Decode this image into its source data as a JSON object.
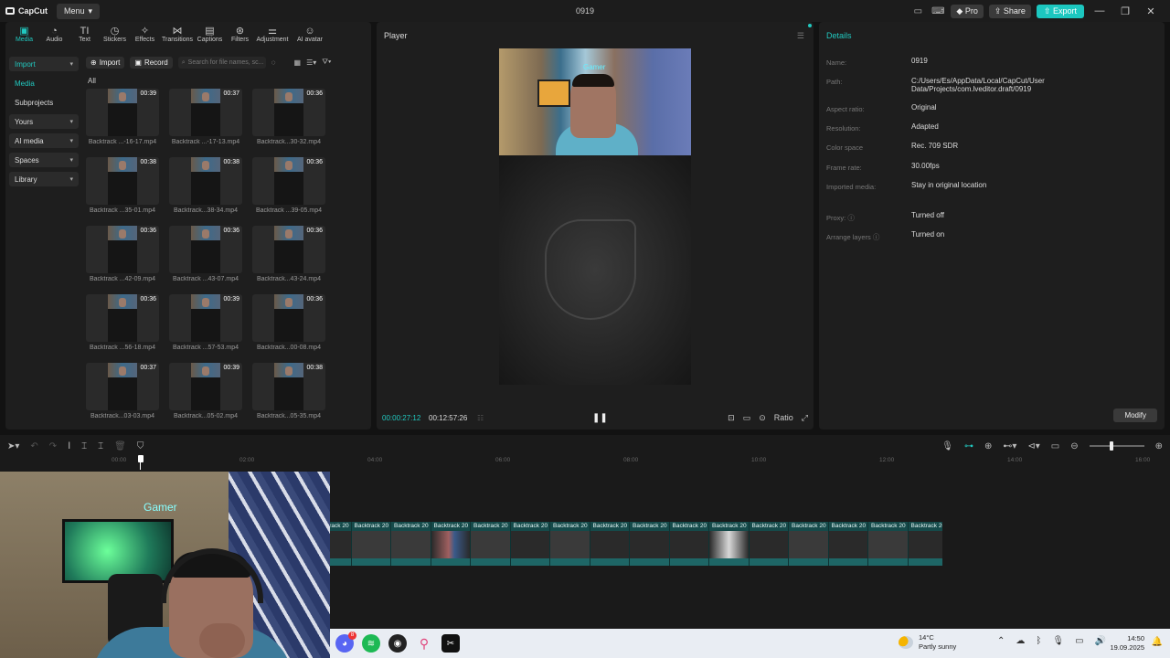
{
  "titlebar": {
    "logo": "CapCut",
    "menu_label": "Menu",
    "project_title": "0919",
    "pro_label": "Pro",
    "share_label": "Share",
    "export_label": "Export"
  },
  "toolbar": {
    "items": [
      {
        "label": "Media",
        "icon": "media-icon"
      },
      {
        "label": "Audio",
        "icon": "audio-icon"
      },
      {
        "label": "Text",
        "icon": "text-icon"
      },
      {
        "label": "Stickers",
        "icon": "stickers-icon"
      },
      {
        "label": "Effects",
        "icon": "effects-icon"
      },
      {
        "label": "Transitions",
        "icon": "transitions-icon"
      },
      {
        "label": "Captions",
        "icon": "captions-icon"
      },
      {
        "label": "Filters",
        "icon": "filters-icon"
      },
      {
        "label": "Adjustment",
        "icon": "adjustment-icon"
      },
      {
        "label": "AI avatar",
        "icon": "ai-avatar-icon"
      }
    ],
    "active": "Media"
  },
  "sidebar": {
    "items": [
      {
        "label": "Import"
      },
      {
        "label": "Media"
      },
      {
        "label": "Subprojects"
      },
      {
        "label": "Yours"
      },
      {
        "label": "AI media"
      },
      {
        "label": "Spaces"
      },
      {
        "label": "Library"
      }
    ]
  },
  "media": {
    "import_label": "Import",
    "record_label": "Record",
    "search_placeholder": "Search for file names, sc...",
    "all_label": "All",
    "clips": [
      {
        "name": "Backtrack ...-16-17.mp4",
        "duration": "00:39"
      },
      {
        "name": "Backtrack ...-17-13.mp4",
        "duration": "00:37"
      },
      {
        "name": "Backtrack...30-32.mp4",
        "duration": "00:36"
      },
      {
        "name": "Backtrack ...35-01.mp4",
        "duration": "00:38"
      },
      {
        "name": "Backtrack...38-34.mp4",
        "duration": "00:38"
      },
      {
        "name": "Backtrack ...39-05.mp4",
        "duration": "00:36"
      },
      {
        "name": "Backtrack ...42-09.mp4",
        "duration": "00:36"
      },
      {
        "name": "Backtrack ...43-07.mp4",
        "duration": "00:36"
      },
      {
        "name": "Backtrack...43-24.mp4",
        "duration": "00:36"
      },
      {
        "name": "Backtrack ...56-18.mp4",
        "duration": "00:36"
      },
      {
        "name": "Backtrack ...57-53.mp4",
        "duration": "00:39"
      },
      {
        "name": "Backtrack...00-08.mp4",
        "duration": "00:36"
      },
      {
        "name": "Backtrack...03-03.mp4",
        "duration": "00:37"
      },
      {
        "name": "Backtrack...05-02.mp4",
        "duration": "00:39"
      },
      {
        "name": "Backtrack...05-35.mp4",
        "duration": "00:38"
      }
    ]
  },
  "player": {
    "title": "Player",
    "current_time": "00:00:27:12",
    "total_time": "00:12:57:26",
    "ratio_label": "Ratio",
    "neon_text": "Gamer"
  },
  "details": {
    "title": "Details",
    "rows": [
      {
        "label": "Name:",
        "value": "0919"
      },
      {
        "label": "Path:",
        "value": "C:/Users/Es/AppData/Local/CapCut/User Data/Projects/com.lveditor.draft/0919"
      },
      {
        "label": "Aspect ratio:",
        "value": "Original"
      },
      {
        "label": "Resolution:",
        "value": "Adapted"
      },
      {
        "label": "Color space",
        "value": "Rec. 709 SDR"
      },
      {
        "label": "Frame rate:",
        "value": "30.00fps"
      },
      {
        "label": "Imported media:",
        "value": "Stay in original location"
      },
      {
        "label": "Proxy:",
        "value": "Turned off"
      },
      {
        "label": "Arrange layers",
        "value": "Turned on"
      }
    ],
    "modify_label": "Modify"
  },
  "timeline": {
    "ruler": [
      "00:00",
      "02:00",
      "04:00",
      "06:00",
      "08:00",
      "10:00",
      "12:00",
      "14:00",
      "16:00"
    ],
    "clip_label": "Backtrack 20",
    "segments": 16
  },
  "taskbar": {
    "temperature": "14°C",
    "weather": "Partly sunny",
    "time": "14:50",
    "date": "19.09.2025",
    "discord_badge": "8"
  }
}
